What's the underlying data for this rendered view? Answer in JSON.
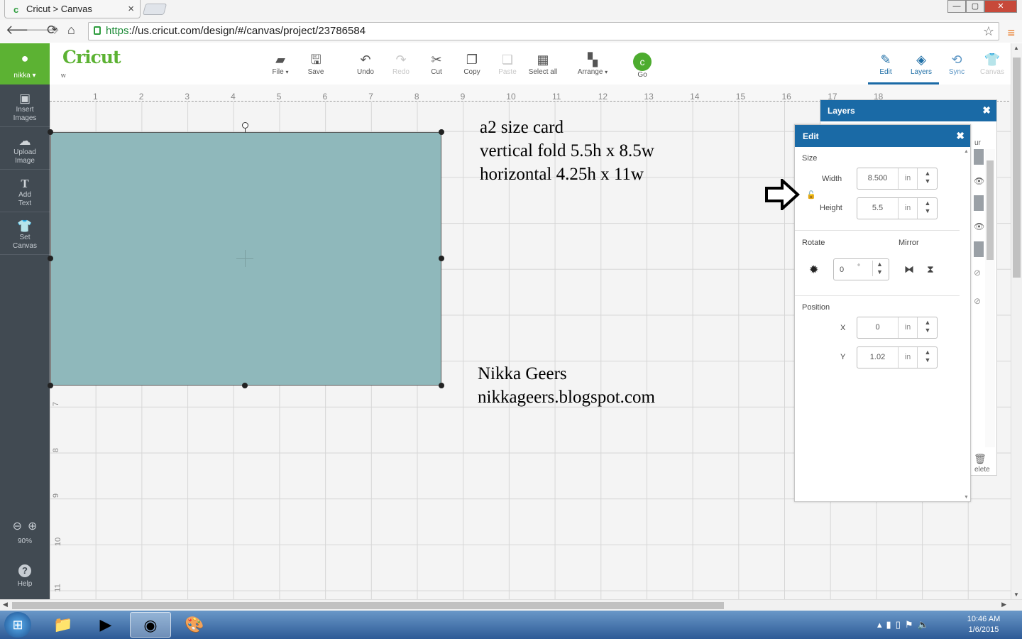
{
  "browser": {
    "tab_title": "Cricut > Canvas",
    "tab_close": "×",
    "url_scheme": "https",
    "url_rest": "://us.cricut.com/design/#/canvas/project/23786584",
    "win_min": "—",
    "win_max": "▢",
    "win_close": "✕"
  },
  "app": {
    "logo": "Cricut",
    "logo_sub": "w",
    "user_name": "nikka ▾",
    "toolbar": [
      {
        "label": "File",
        "icon": "folder-icon",
        "caret": "▾",
        "enabled": true
      },
      {
        "label": "Save",
        "icon": "save-icon",
        "enabled": true
      },
      {
        "label": "Undo",
        "icon": "undo-icon",
        "enabled": true
      },
      {
        "label": "Redo",
        "icon": "redo-icon",
        "enabled": false
      },
      {
        "label": "Cut",
        "icon": "cut-icon",
        "enabled": true
      },
      {
        "label": "Copy",
        "icon": "copy-icon",
        "enabled": true
      },
      {
        "label": "Paste",
        "icon": "paste-icon",
        "enabled": false
      },
      {
        "label": "Select all",
        "icon": "select-all-icon",
        "enabled": true
      },
      {
        "label": "Arrange",
        "icon": "arrange-icon",
        "caret": "▾",
        "enabled": true
      },
      {
        "label": "Go",
        "icon": "go-icon",
        "enabled": true
      }
    ],
    "right_tools": [
      {
        "label": "Edit",
        "icon": "edit-icon",
        "active": true
      },
      {
        "label": "Layers",
        "icon": "layers-icon",
        "active": true
      },
      {
        "label": "Sync",
        "icon": "sync-icon",
        "active": false
      },
      {
        "label": "Canvas",
        "icon": "canvas-icon",
        "active": false
      }
    ],
    "sidebar": [
      {
        "line1": "Insert",
        "line2": "Images",
        "icon": "image-icon"
      },
      {
        "line1": "Upload",
        "line2": "Image",
        "icon": "upload-icon"
      },
      {
        "line1": "Add",
        "line2": "Text",
        "icon": "text-icon"
      },
      {
        "line1": "Set",
        "line2": "Canvas",
        "icon": "shirt-icon"
      }
    ],
    "zoom_level": "90%",
    "help_label": "Help"
  },
  "canvas": {
    "ruler_top": [
      "1",
      "2",
      "3",
      "4",
      "5",
      "6",
      "7",
      "8",
      "9",
      "10",
      "11",
      "12",
      "13",
      "14",
      "15",
      "16",
      "17",
      "18"
    ],
    "ruler_left": [
      "7",
      "8",
      "9",
      "10",
      "11"
    ],
    "note1": [
      "a2 size card",
      "vertical fold 5.5h x 8.5w",
      "horizontal 4.25h x 11w"
    ],
    "note2": [
      "Nikka Geers",
      "nikkageers.blogspot.com"
    ],
    "card_color": "#8fb8bb"
  },
  "layers_panel": {
    "title": "Layers",
    "close": "✖",
    "partial_label": "ur",
    "delete_partial": "elete"
  },
  "edit_panel": {
    "title": "Edit",
    "close": "✖",
    "size_label": "Size",
    "width_label": "Width",
    "width_value": "8.500",
    "width_unit": "in",
    "height_label": "Height",
    "height_value": "5.5",
    "height_unit": "in",
    "rotate_label": "Rotate",
    "rotate_value": "0",
    "rotate_unit": "°",
    "mirror_label": "Mirror",
    "position_label": "Position",
    "x_label": "X",
    "x_value": "0",
    "x_unit": "in",
    "y_label": "Y",
    "y_value": "1.02",
    "y_unit": "in"
  },
  "taskbar": {
    "time": "10:46 AM",
    "date": "1/6/2015"
  },
  "colors": {
    "brand_green": "#5cb233",
    "panel_blue": "#1a6aa6",
    "sidebar_dark": "#414a52"
  }
}
